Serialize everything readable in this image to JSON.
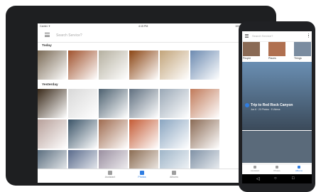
{
  "tablet": {
    "status": {
      "carrier": "Carrier ✦",
      "time": "4:15 PM",
      "battery": "100% ▬"
    },
    "search_placeholder": "Search Service?",
    "sections": [
      {
        "label": "Today",
        "photos": [
          "#7a6a55",
          "#a0522d",
          "#b5b0a0",
          "#8b4513",
          "#c2a47a",
          "#6c8ab0"
        ]
      },
      {
        "label": "Yesterday",
        "photos": [
          "#3a2a1a",
          "#d8d8d8",
          "#4d6170",
          "#607080",
          "#9aa8b6",
          "#c07a5a",
          "#b7a09a",
          "#3b5468",
          "#9f6b4f",
          "#c45b35",
          "#8aa5c0",
          "#8a6a54",
          "#5b6e7f",
          "#5a6b8c",
          "#9a8fa0",
          "#8b6c52",
          "#9fb5c8",
          "#7f91a5"
        ]
      }
    ],
    "nav": [
      {
        "label": "Assistant",
        "icon": "assistant-icon",
        "active": false
      },
      {
        "label": "Photos",
        "icon": "photos-icon",
        "active": true
      },
      {
        "label": "Albums",
        "icon": "albums-icon",
        "active": false
      }
    ]
  },
  "phone": {
    "search_placeholder": "Search Service?",
    "thumbs": [
      {
        "label": "People",
        "color": "#8a6a55"
      },
      {
        "label": "Places",
        "color": "#b07050"
      },
      {
        "label": "Things",
        "color": "#7a8ca0"
      }
    ],
    "card": {
      "title": "Trip to Red Rock Canyon",
      "subtitle": "Jun 6 · 20 Photos · 5 Videos",
      "color": "#6a8fb3"
    },
    "row2_color": "#5a6a7a",
    "nav": [
      {
        "label": "Assistant",
        "icon": "assistant-icon",
        "active": false
      },
      {
        "label": "Photos",
        "icon": "photos-icon",
        "active": false
      },
      {
        "label": "Albums",
        "icon": "albums-icon",
        "active": true
      }
    ],
    "system_nav": {
      "back": "◁",
      "home": "○",
      "recents": "□"
    }
  }
}
